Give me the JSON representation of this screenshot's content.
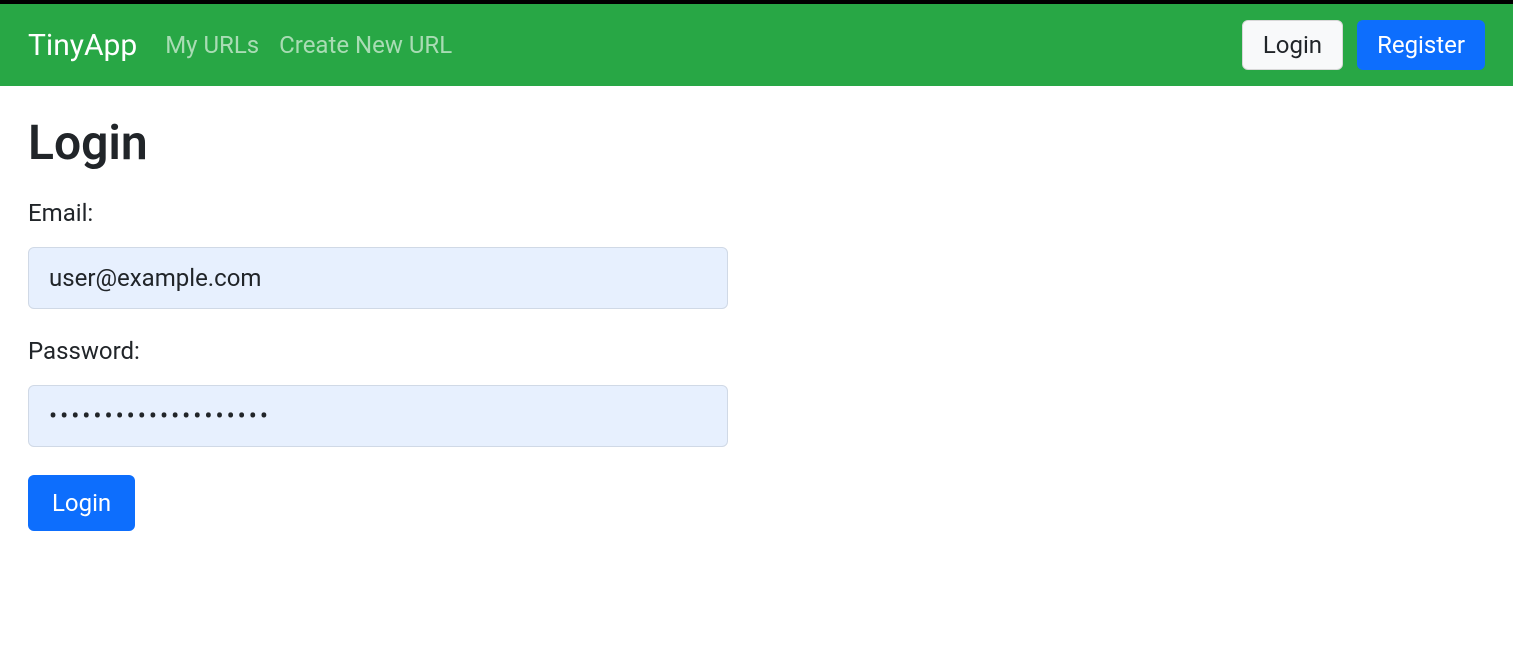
{
  "navbar": {
    "brand": "TinyApp",
    "links": {
      "my_urls": "My URLs",
      "create_new": "Create New URL"
    },
    "buttons": {
      "login": "Login",
      "register": "Register"
    }
  },
  "page": {
    "title": "Login"
  },
  "form": {
    "email_label": "Email:",
    "email_value": "user@example.com",
    "password_label": "Password:",
    "password_value": "••••••••••••••••••••",
    "submit_label": "Login"
  }
}
